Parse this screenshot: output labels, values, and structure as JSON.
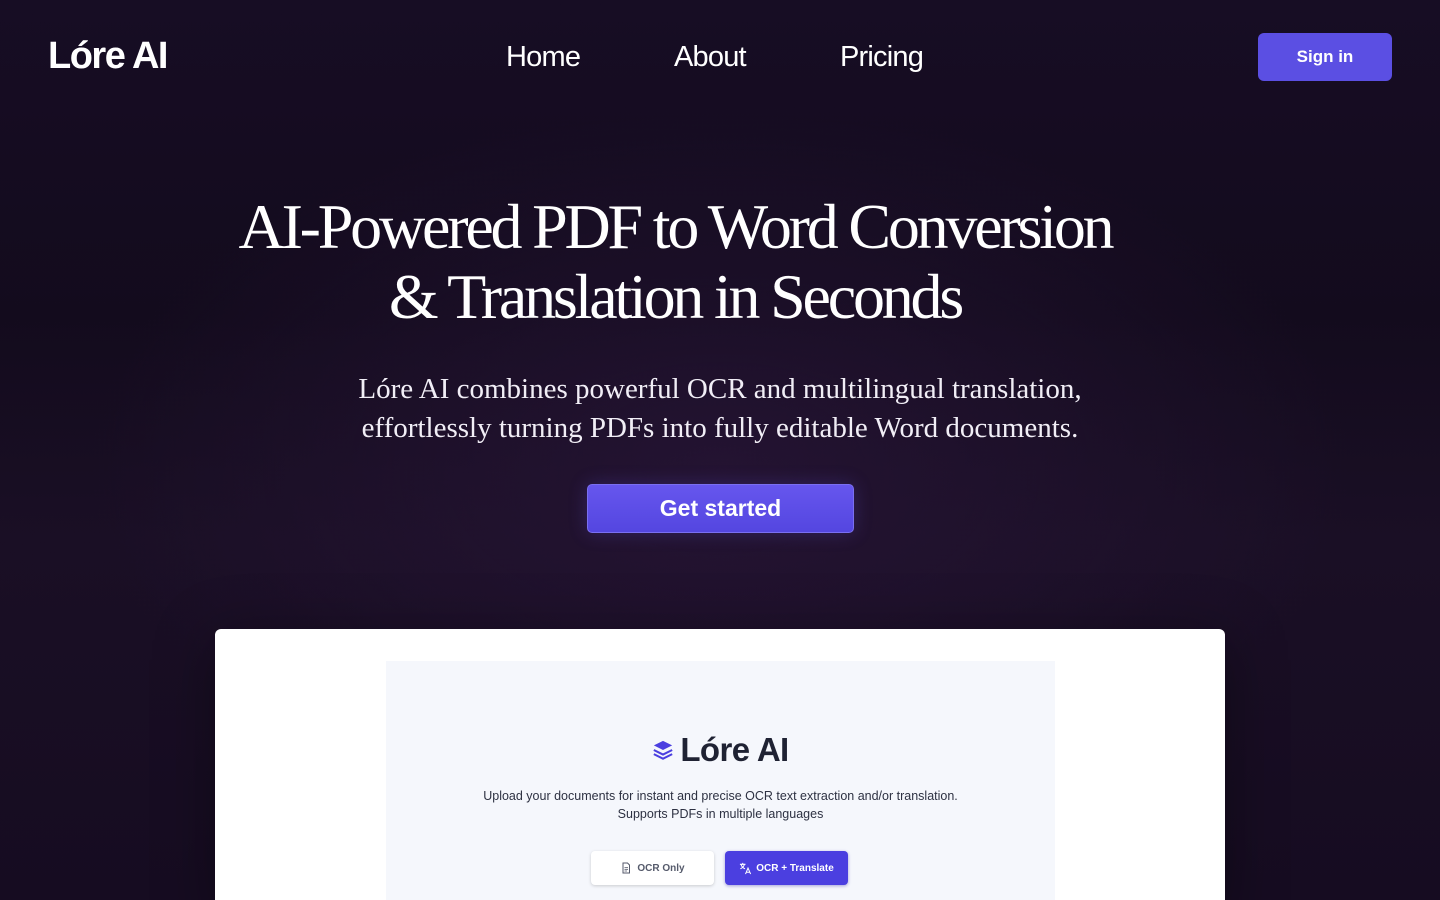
{
  "header": {
    "logo": "Lóre AI",
    "nav": [
      {
        "label": "Home"
      },
      {
        "label": "About"
      },
      {
        "label": "Pricing"
      }
    ],
    "signin_label": "Sign in"
  },
  "hero": {
    "title_line1": "AI-Powered PDF to Word Conversion",
    "title_line2": "& Translation in Seconds",
    "subtitle_line1": "Lóre AI combines powerful OCR and multilingual translation,",
    "subtitle_line2": "effortlessly turning PDFs into fully editable Word documents.",
    "cta_label": "Get started"
  },
  "preview": {
    "brand": "Lóre AI",
    "brand_icon": "layers-icon",
    "description_line1": "Upload your documents for instant and precise OCR text extraction and/or translation.",
    "description_line2": "Supports PDFs in multiple languages",
    "modes": [
      {
        "label": "OCR Only",
        "icon": "document-icon",
        "selected": false
      },
      {
        "label": "OCR + Translate",
        "icon": "translate-icon",
        "selected": true
      }
    ]
  },
  "colors": {
    "accent": "#5b4fe3",
    "background": "#150c20",
    "card": "#ffffff",
    "selected_mode": "#4b3fe0"
  }
}
